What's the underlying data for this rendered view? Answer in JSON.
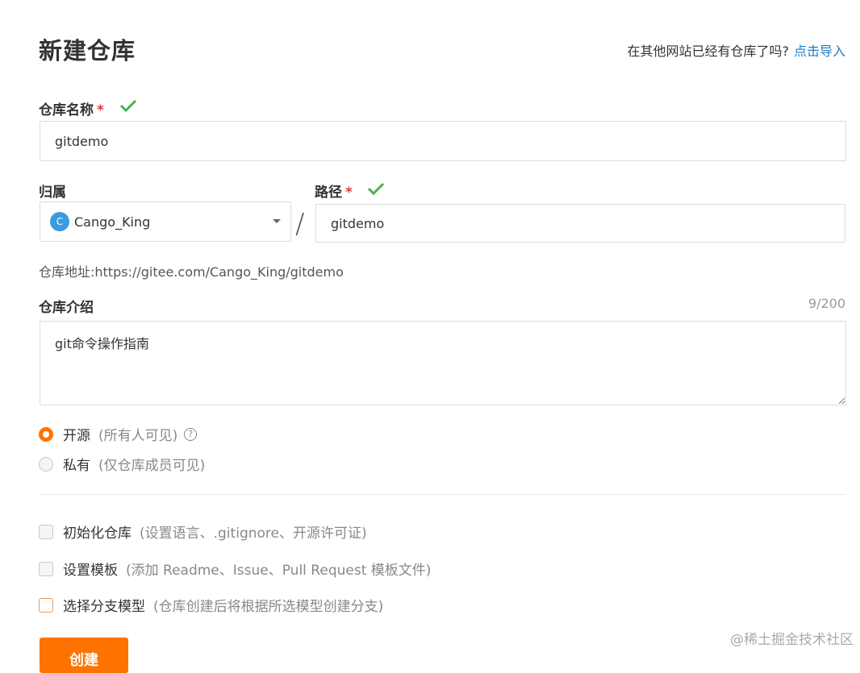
{
  "page": {
    "title": "新建仓库",
    "import_hint": "在其他网站已经有仓库了吗?",
    "import_link": "点击导入"
  },
  "repo_name": {
    "label": "仓库名称",
    "required_mark": "*",
    "value": "gitdemo"
  },
  "owner": {
    "label": "归属",
    "avatar_letter": "C",
    "value": "Cango_King"
  },
  "separator": "/",
  "path": {
    "label": "路径",
    "required_mark": "*",
    "value": "gitdemo"
  },
  "repo_address": "仓库地址:https://gitee.com/Cango_King/gitdemo",
  "description": {
    "label": "仓库介绍",
    "counter": "9/200",
    "value": "git命令操作指南"
  },
  "visibility": {
    "public_label": "开源",
    "public_note": "(所有人可见)",
    "help_glyph": "?",
    "private_label": "私有",
    "private_note": "(仅仓库成员可见)",
    "selected": "public"
  },
  "options": [
    {
      "label": "初始化仓库",
      "note": "(设置语言、.gitignore、开源许可证)"
    },
    {
      "label": "设置模板",
      "note": "(添加 Readme、Issue、Pull Request 模板文件)"
    },
    {
      "label": "选择分支模型",
      "note": "(仓库创建后将根据所选模型创建分支)"
    }
  ],
  "create_button": "创建",
  "watermark": "@稀土掘金技术社区",
  "colors": {
    "accent": "#fe7300",
    "link": "#1c7dc4",
    "valid": "#4caf50",
    "required": "#e53935"
  }
}
